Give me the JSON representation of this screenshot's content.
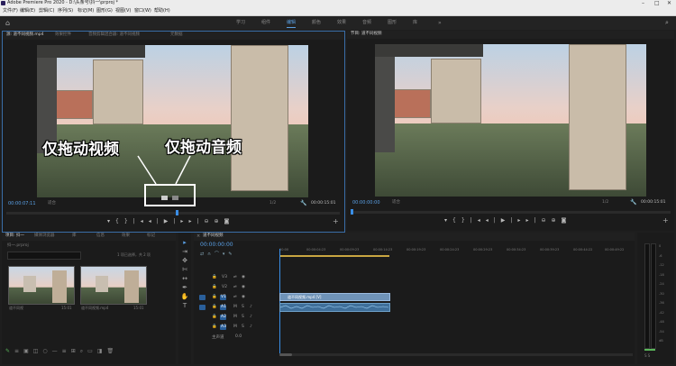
{
  "window": {
    "title": "Adobe Premiere Pro 2020 - D:\\头条号\\抖一\\prproj *"
  },
  "menu": [
    "文件(F)",
    "编辑(E)",
    "剪辑(C)",
    "序列(S)",
    "标记(M)",
    "图形(G)",
    "视图(V)",
    "窗口(W)",
    "帮助(H)"
  ],
  "workspaces": [
    {
      "label": "学习"
    },
    {
      "label": "组件"
    },
    {
      "label": "编辑",
      "active": true
    },
    {
      "label": "颜色"
    },
    {
      "label": "效果"
    },
    {
      "label": "音频"
    },
    {
      "label": "图形"
    },
    {
      "label": "库"
    }
  ],
  "source": {
    "tabs": [
      "源: 道不同视频.mp4",
      "效果控件",
      "音频剪辑混合器: 道不同视频",
      "元数据"
    ],
    "timecode_left": "00:00:07:11",
    "fit": "适合",
    "fraction": "1/2",
    "timecode_right": "00:00:15:01"
  },
  "program": {
    "tabs": [
      "节目: 道不同视频"
    ],
    "timecode_left": "00:00:00:00",
    "fit": "适合",
    "fraction": "1/2",
    "timecode_right": "00:00:15:01"
  },
  "overlay": {
    "video_only": "仅拖动视频",
    "audio_only": "仅拖动音频"
  },
  "project": {
    "tabs": [
      "项目: 抖一",
      "媒体浏览器",
      "库",
      "信息",
      "效果",
      "标记"
    ],
    "path": "抖一.prproj",
    "items_count": "1 项已选择，共 2 项",
    "items": [
      {
        "name": "道不同视",
        "duration": "15:01"
      },
      {
        "name": "道不同视频.mp4",
        "duration": "15:01"
      }
    ]
  },
  "timeline": {
    "tab": "道不同视频",
    "timecode": "00:00:00:00",
    "ruler": [
      "00:00",
      "00:00:04:23",
      "00:00:09:23",
      "00:00:14:23",
      "00:00:19:23",
      "00:00:24:23",
      "00:00:29:23",
      "00:00:34:23",
      "00:00:39:23",
      "00:00:44:22",
      "00:00:49:22"
    ],
    "video_tracks": [
      "V3",
      "V2",
      "V1"
    ],
    "audio_tracks": [
      "A1",
      "A2",
      "A3"
    ],
    "master": "主声道",
    "master_value": "0.0",
    "video_clip": "道不同视频.mp4 [V]"
  },
  "meter": {
    "labels": [
      "0",
      "-6",
      "-12",
      "-18",
      "-24",
      "-30",
      "-36",
      "-42",
      "-48",
      "-54",
      "dB"
    ],
    "bottom": "S S"
  }
}
